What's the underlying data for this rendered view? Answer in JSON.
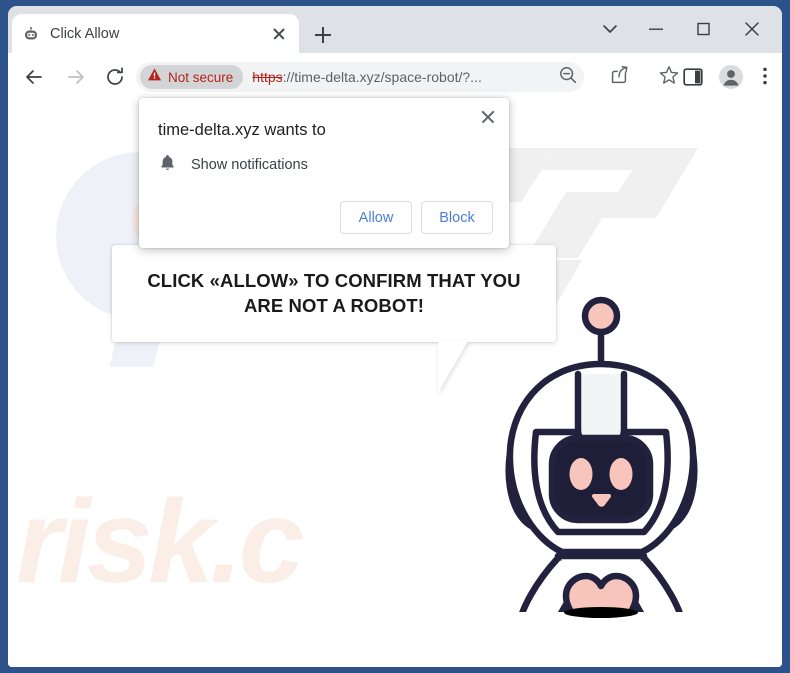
{
  "window": {
    "controls": [
      {
        "name": "tab-search",
        "icon": "chevron-down-icon"
      },
      {
        "name": "minimize",
        "icon": "minimize-icon"
      },
      {
        "name": "maximize",
        "icon": "maximize-icon"
      },
      {
        "name": "close",
        "icon": "close-icon"
      }
    ]
  },
  "tabs": [
    {
      "title": "Click Allow",
      "favicon": "robot-favicon",
      "close_label": "×"
    }
  ],
  "new_tab_label": "+",
  "toolbar": {
    "back": "back-icon",
    "forward": "forward-icon",
    "reload": "reload-icon",
    "security": {
      "icon": "warning-triangle-icon",
      "label": "Not secure"
    },
    "url": {
      "scheme": "https",
      "rest": "://time-delta.xyz/space-robot/?...",
      "full": "https://time-delta.xyz/space-robot/?..."
    },
    "actions": [
      {
        "name": "zoom-out-icon",
        "title": "Zoom"
      },
      {
        "name": "share-icon",
        "title": "Share"
      },
      {
        "name": "bookmark-star-icon",
        "title": "Bookmark"
      },
      {
        "name": "side-panel-icon",
        "title": "Side panel"
      },
      {
        "name": "profile-avatar-icon",
        "title": "Profile"
      },
      {
        "name": "three-dot-menu-icon",
        "title": "Customize and control"
      }
    ]
  },
  "permission_dialog": {
    "heading": "time-delta.xyz wants to",
    "request_icon": "bell-icon",
    "request_label": "Show notifications",
    "allow_label": "Allow",
    "block_label": "Block",
    "close_label": "×"
  },
  "page": {
    "bubble_text_line1": "CLICK «ALLOW» TO CONFIRM THAT YOU",
    "bubble_text_line2": "ARE NOT A ROBOT!",
    "watermark_text": "risk.c",
    "mascot": "space-robot-mascot"
  },
  "colors": {
    "frame_blue": "#2c5289",
    "tabstrip_gray": "#dee1e6",
    "not_secure_red": "#b3261e",
    "omnibox_gray": "#f1f3f4",
    "button_blue": "#4a7fd6",
    "robot_outline": "#22223f",
    "robot_pink": "#f7c5bc",
    "robot_screen": "#1e1e38",
    "watermark_pink": "#fbeee6",
    "watermark_gray": "#f0f0f0"
  }
}
